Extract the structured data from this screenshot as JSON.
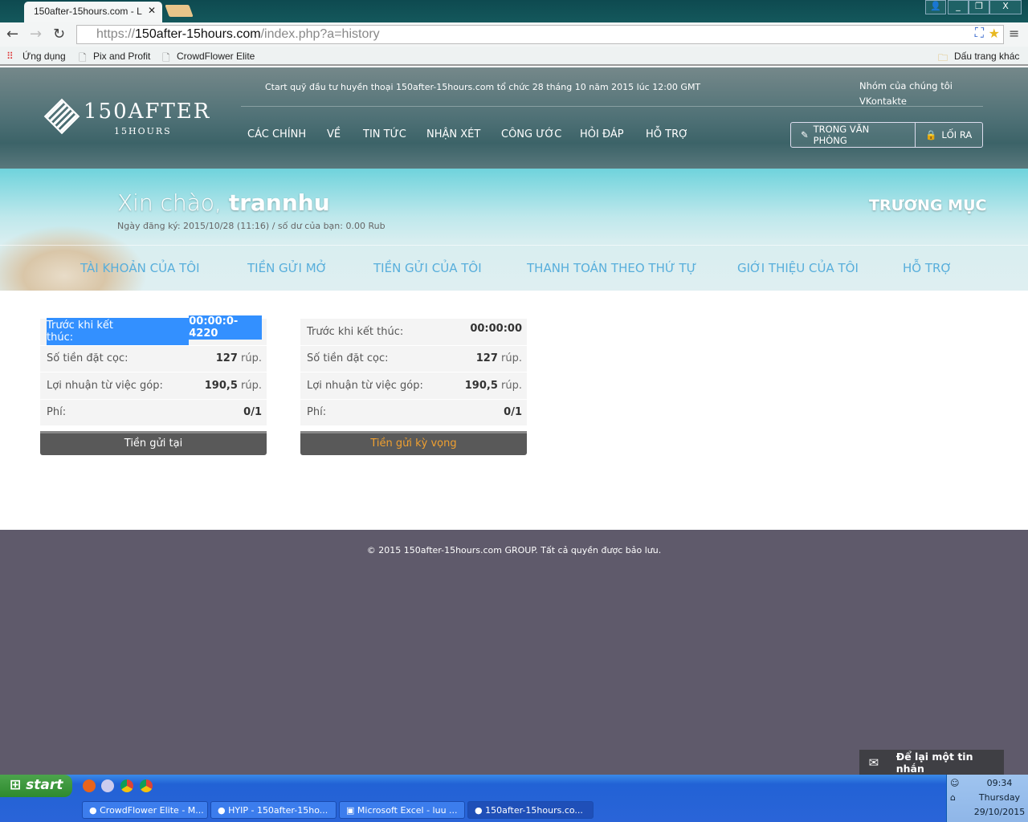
{
  "browser": {
    "tab_title": "150after-15hours.com - L",
    "url_scheme": "https://",
    "url_host": "150after-15hours.com",
    "url_path": "/index.php?a=history",
    "bookmarks": [
      "Ứng dụng",
      "Pix and Profit",
      "CrowdFlower Elite"
    ],
    "other_bookmarks": "Dấu trang khác"
  },
  "header": {
    "logo_main": "150AFTER",
    "logo_sub": "15HOURS",
    "announcement": "Ctart quỹ đầu tư huyền thoại 150after-15hours.com tổ chức 28 tháng 10 năm 2015 lúc 12:00 GMT",
    "social": [
      "Nhóm của chúng tôi",
      "VKontakte"
    ],
    "nav": [
      "CÁC CHÍNH",
      "VỀ",
      "TIN TỨC",
      "NHẬN XÉT",
      "CÔNG ƯỚC",
      "HỎI ĐÁP",
      "HỖ TRỢ"
    ],
    "office_button": "TRONG VĂN PHÒNG",
    "logout_button": "LỐI RA"
  },
  "banner": {
    "greeting": "Xin chào,",
    "username": "trannhu",
    "reg_info": "Ngày đăng ký: 2015/10/28 (11:16) / số dư của bạn: 0.00 Rub",
    "section_title": "TRƯƠNG MỤC",
    "subnav": [
      "TÀI KHOẢN CỦA TÔI",
      "TIỀN GỬI MỞ",
      "TIỀN GỬI CỦA TÔI",
      "THANH TOÁN THEO THỨ TỰ",
      "GIỚI THIỆU CỦA TÔI",
      "HỖ TRỢ"
    ]
  },
  "deposits": [
    {
      "labels": [
        "Trước khi kết thúc:",
        "Số tiền đặt cọc:",
        "Lợi nhuận từ việc góp:",
        "Phí:"
      ],
      "time": "00:00:0-4220",
      "amount": "127",
      "profit": "190,5",
      "fee": "0/1",
      "unit": "rúp.",
      "button": "Tiền gửi tại",
      "button_color": "#ffffff"
    },
    {
      "labels": [
        "Trước khi kết thúc:",
        "Số tiền đặt cọc:",
        "Lợi nhuận từ việc góp:",
        "Phí:"
      ],
      "time": "00:00:00",
      "amount": "127",
      "profit": "190,5",
      "fee": "0/1",
      "unit": "rúp.",
      "button": "Tiền gửi kỳ vọng",
      "button_color": "#f0a030"
    }
  ],
  "footer": {
    "copyright": "© 2015 150after-15hours.com GROUP. Tất cả quyền được bảo lưu.",
    "message_button": "Để lại một tin nhắn"
  },
  "taskbar": {
    "start": "start",
    "tasks": [
      "CrowdFlower Elite - M...",
      "HYIP - 150after-15ho...",
      "Microsoft Excel - luu ...",
      "150after-15hours.co..."
    ],
    "time": "09:34",
    "day": "Thursday",
    "date": "29/10/2015"
  }
}
